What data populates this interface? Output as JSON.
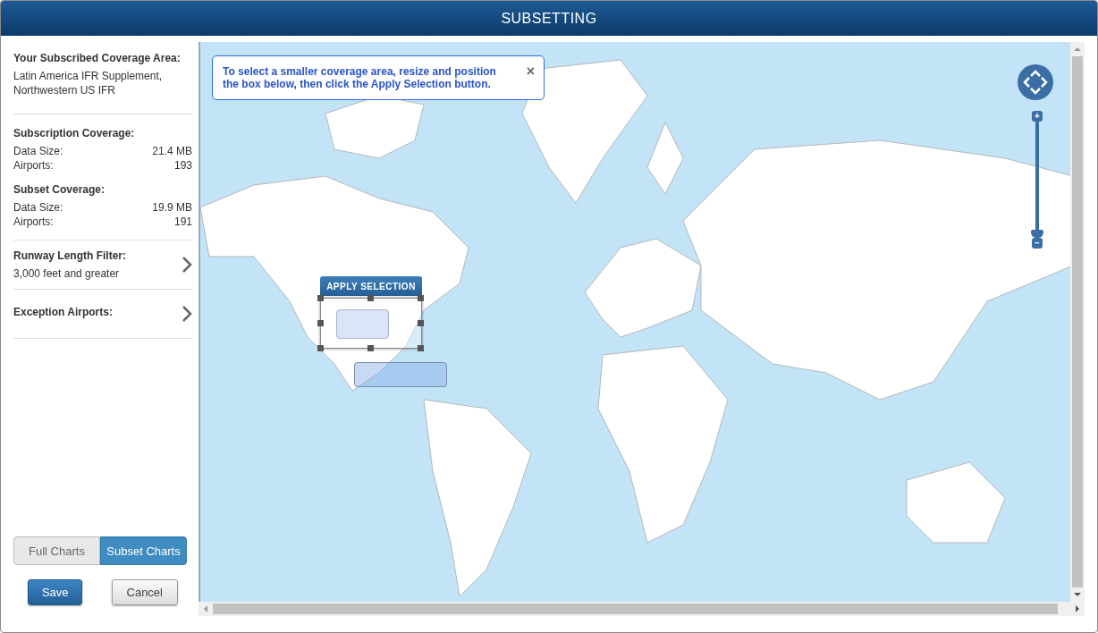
{
  "window": {
    "title": "SUBSETTING"
  },
  "sidebar": {
    "subscribed": {
      "heading": "Your Subscribed Coverage Area:",
      "value": "Latin America IFR Supplement, Northwestern US IFR"
    },
    "sections": [
      {
        "heading": "Subscription Coverage:",
        "rows": [
          {
            "label": "Data Size:",
            "value": "21.4 MB"
          },
          {
            "label": "Airports:",
            "value": "193"
          }
        ]
      },
      {
        "heading": "Subset Coverage:",
        "rows": [
          {
            "label": "Data Size:",
            "value": "19.9 MB"
          },
          {
            "label": "Airports:",
            "value": "191"
          }
        ]
      }
    ],
    "filters": [
      {
        "heading": "Runway Length Filter:",
        "value": "3,000 feet and greater"
      },
      {
        "heading": "Exception Airports:"
      }
    ],
    "modes": [
      {
        "label": "Full Charts",
        "selected": false
      },
      {
        "label": "Subset Charts",
        "selected": true
      }
    ],
    "buttons": [
      {
        "label": "Save",
        "kind": "primary"
      },
      {
        "label": "Cancel",
        "kind": "secondary"
      }
    ]
  },
  "map": {
    "notice": "To select a smaller coverage area, resize and position the box below, then click the Apply Selection button.",
    "close": "×",
    "apply_button": "APPLY SELECTION",
    "zoom": {
      "plus": "+",
      "minus": "−",
      "level": 0
    }
  }
}
